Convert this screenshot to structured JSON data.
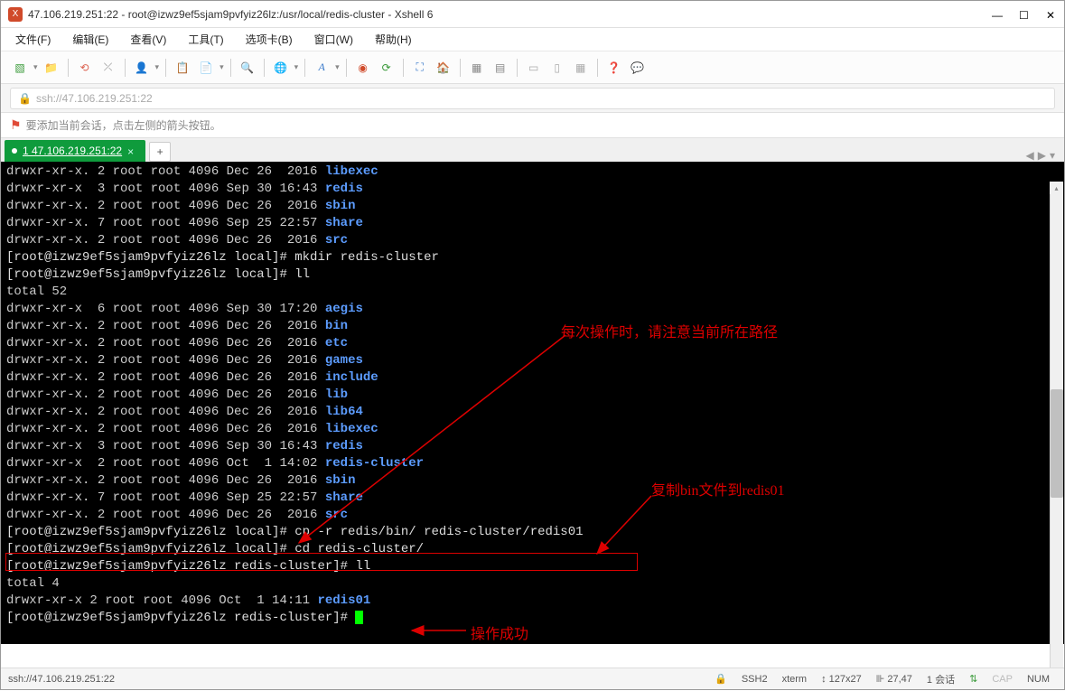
{
  "window": {
    "title": "47.106.219.251:22 - root@izwz9ef5sjam9pvfyiz26lz:/usr/local/redis-cluster - Xshell 6"
  },
  "menu": {
    "file": "文件(F)",
    "edit": "编辑(E)",
    "view": "查看(V)",
    "tools": "工具(T)",
    "tabs": "选项卡(B)",
    "window": "窗口(W)",
    "help": "帮助(H)"
  },
  "addressbar": {
    "text": "ssh://47.106.219.251:22"
  },
  "hint": {
    "text": "要添加当前会话，点击左侧的箭头按钮。"
  },
  "tab": {
    "label": "1 47.106.219.251:22"
  },
  "annotations": {
    "a1": "每次操作时，请注意当前所在路径",
    "a2": "复制bin文件到redis01",
    "a3": "操作成功"
  },
  "terminal": {
    "lines": [
      {
        "perm": "drwxr-xr-x.",
        "n": "2",
        "o": "root",
        "g": "root",
        "sz": "4096",
        "dt": "Dec 26  2016",
        "name": "libexec"
      },
      {
        "perm": "drwxr-xr-x ",
        "n": "3",
        "o": "root",
        "g": "root",
        "sz": "4096",
        "dt": "Sep 30 16:43",
        "name": "redis"
      },
      {
        "perm": "drwxr-xr-x.",
        "n": "2",
        "o": "root",
        "g": "root",
        "sz": "4096",
        "dt": "Dec 26  2016",
        "name": "sbin"
      },
      {
        "perm": "drwxr-xr-x.",
        "n": "7",
        "o": "root",
        "g": "root",
        "sz": "4096",
        "dt": "Sep 25 22:57",
        "name": "share"
      },
      {
        "perm": "drwxr-xr-x.",
        "n": "2",
        "o": "root",
        "g": "root",
        "sz": "4096",
        "dt": "Dec 26  2016",
        "name": "src"
      }
    ],
    "cmd_mkdir": "[root@izwz9ef5sjam9pvfyiz26lz local]# mkdir redis-cluster",
    "cmd_ll1": "[root@izwz9ef5sjam9pvfyiz26lz local]# ll",
    "total1": "total 52",
    "lines2": [
      {
        "perm": "drwxr-xr-x ",
        "n": "6",
        "o": "root",
        "g": "root",
        "sz": "4096",
        "dt": "Sep 30 17:20",
        "name": "aegis"
      },
      {
        "perm": "drwxr-xr-x.",
        "n": "2",
        "o": "root",
        "g": "root",
        "sz": "4096",
        "dt": "Dec 26  2016",
        "name": "bin"
      },
      {
        "perm": "drwxr-xr-x.",
        "n": "2",
        "o": "root",
        "g": "root",
        "sz": "4096",
        "dt": "Dec 26  2016",
        "name": "etc"
      },
      {
        "perm": "drwxr-xr-x.",
        "n": "2",
        "o": "root",
        "g": "root",
        "sz": "4096",
        "dt": "Dec 26  2016",
        "name": "games"
      },
      {
        "perm": "drwxr-xr-x.",
        "n": "2",
        "o": "root",
        "g": "root",
        "sz": "4096",
        "dt": "Dec 26  2016",
        "name": "include"
      },
      {
        "perm": "drwxr-xr-x.",
        "n": "2",
        "o": "root",
        "g": "root",
        "sz": "4096",
        "dt": "Dec 26  2016",
        "name": "lib"
      },
      {
        "perm": "drwxr-xr-x.",
        "n": "2",
        "o": "root",
        "g": "root",
        "sz": "4096",
        "dt": "Dec 26  2016",
        "name": "lib64"
      },
      {
        "perm": "drwxr-xr-x.",
        "n": "2",
        "o": "root",
        "g": "root",
        "sz": "4096",
        "dt": "Dec 26  2016",
        "name": "libexec"
      },
      {
        "perm": "drwxr-xr-x ",
        "n": "3",
        "o": "root",
        "g": "root",
        "sz": "4096",
        "dt": "Sep 30 16:43",
        "name": "redis"
      },
      {
        "perm": "drwxr-xr-x ",
        "n": "2",
        "o": "root",
        "g": "root",
        "sz": "4096",
        "dt": "Oct  1 14:02",
        "name": "redis-cluster"
      },
      {
        "perm": "drwxr-xr-x.",
        "n": "2",
        "o": "root",
        "g": "root",
        "sz": "4096",
        "dt": "Dec 26  2016",
        "name": "sbin"
      },
      {
        "perm": "drwxr-xr-x.",
        "n": "7",
        "o": "root",
        "g": "root",
        "sz": "4096",
        "dt": "Sep 25 22:57",
        "name": "share"
      },
      {
        "perm": "drwxr-xr-x.",
        "n": "2",
        "o": "root",
        "g": "root",
        "sz": "4096",
        "dt": "Dec 26  2016",
        "name": "src"
      }
    ],
    "cmd_cp": "[root@izwz9ef5sjam9pvfyiz26lz local]# cp -r redis/bin/ redis-cluster/redis01",
    "cmd_cd": "[root@izwz9ef5sjam9pvfyiz26lz local]# cd redis-cluster/",
    "cmd_ll2": "[root@izwz9ef5sjam9pvfyiz26lz redis-cluster]# ll",
    "total2": "total 4",
    "line3": {
      "perm": "drwxr-xr-x",
      "n": "2",
      "o": "root",
      "g": "root",
      "sz": "4096",
      "dt": "Oct  1 14:11",
      "name": "redis01"
    },
    "prompt_final": "[root@izwz9ef5sjam9pvfyiz26lz redis-cluster]# "
  },
  "statusbar": {
    "addr": "ssh://47.106.219.251:22",
    "ssh": "SSH2",
    "term": "xterm",
    "size": "127x27",
    "cursor": "27,47",
    "sessions": "1 会话",
    "cap": "CAP",
    "num": "NUM"
  }
}
